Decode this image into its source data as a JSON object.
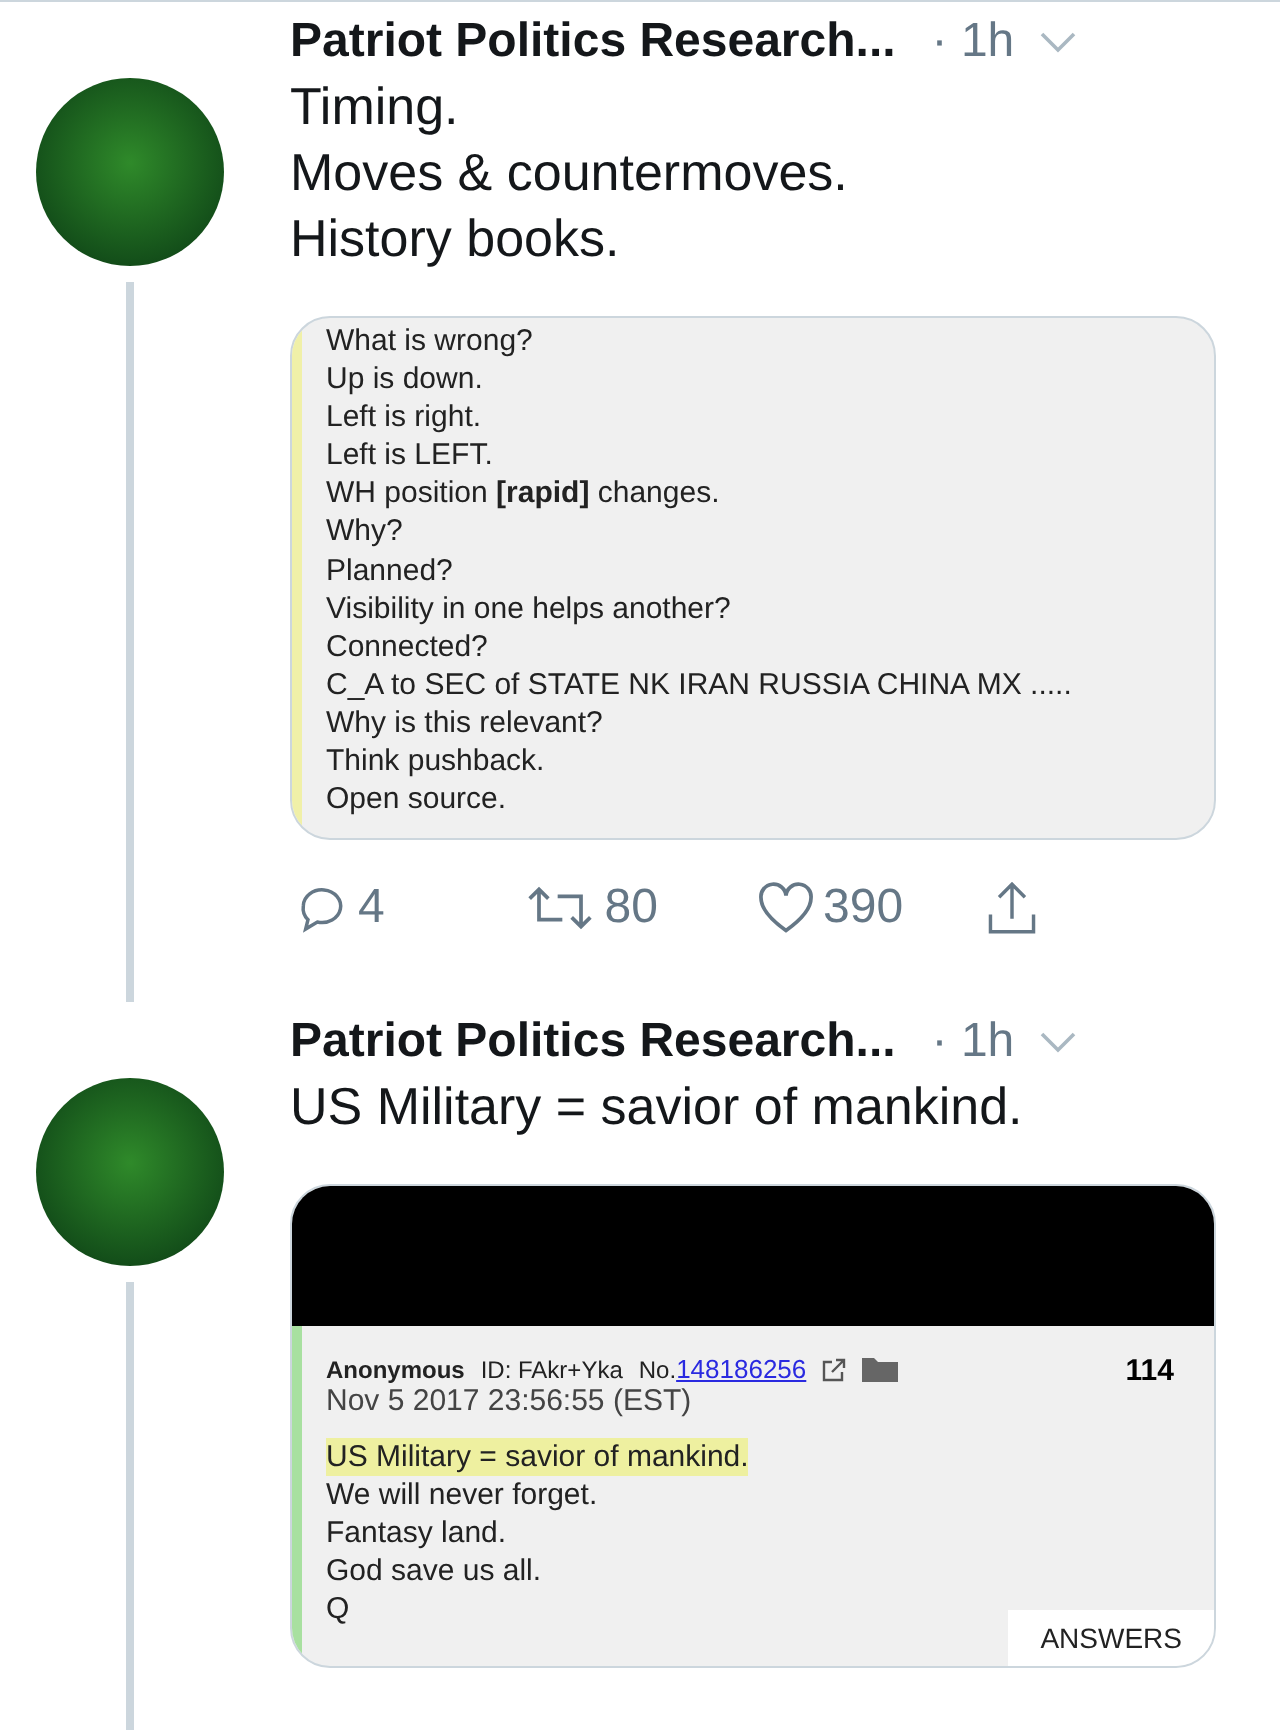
{
  "tweets": [
    {
      "author": "Patriot Politics Research...",
      "time": "· 1h",
      "text": [
        "Timing.",
        "Moves & countermoves.",
        "History books."
      ],
      "attachment": {
        "kind": "notes",
        "lines": [
          "What is wrong?",
          "Up is down.",
          "Left is right.",
          "Left is LEFT.",
          "WH position **[rapid]** changes.",
          "Why?",
          "Planned?",
          "Visibility in one helps another?",
          "Connected?",
          "C_A to SEC of STATE NK IRAN RUSSIA CHINA MX .....",
          "Why is this relevant?",
          "Think pushback.",
          "Open source."
        ]
      },
      "actions": [
        {
          "kind": "reply",
          "count": "4"
        },
        {
          "kind": "retweet",
          "count": "80"
        },
        {
          "kind": "like",
          "count": "390"
        },
        {
          "kind": "share"
        }
      ]
    },
    {
      "author": "Patriot Politics Research...",
      "time": "· 1h",
      "text": [
        "US Military = savior of mankind."
      ],
      "attachment": {
        "kind": "post",
        "poster": "Anonymous",
        "id": "ID: FAkr+Yka",
        "number_prefix": "No.",
        "number": "148186256",
        "replies": "114",
        "date": "Nov 5 2017 23:56:55 (EST)",
        "lines": [
          {
            "text": "US Military = savior of mankind.",
            "highlighted": true
          },
          {
            "text": "We will never forget.",
            "highlighted": false
          },
          {
            "text": "Fantasy land.",
            "highlighted": false
          },
          {
            "text": "God save us all.",
            "highlighted": false
          },
          {
            "text": "Q",
            "highlighted": false
          }
        ],
        "button": "ANSWERS"
      }
    }
  ]
}
